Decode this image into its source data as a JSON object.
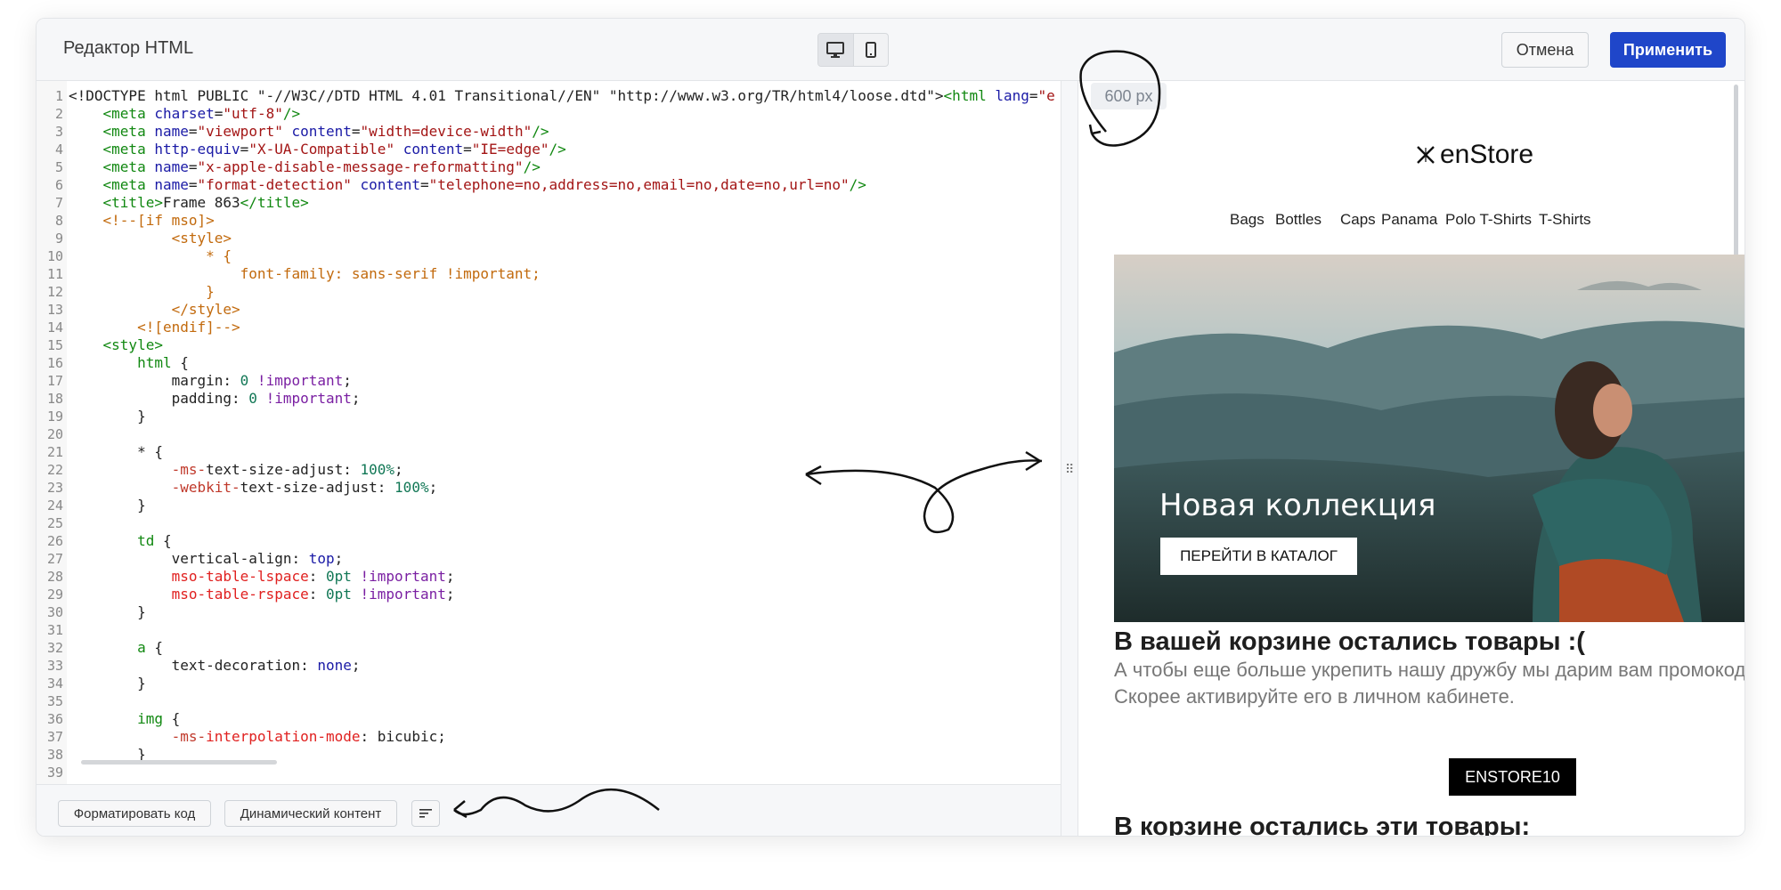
{
  "header": {
    "title": "Редактор HTML",
    "cancel_label": "Отмена",
    "apply_label": "Применить",
    "device_buttons": [
      "desktop-icon",
      "mobile-icon"
    ]
  },
  "editor": {
    "lines": [
      {
        "n": "1",
        "segs": [
          [
            "<!DOCTYPE html PUBLIC \"-//W3C//DTD HTML 4.01 Transitional//EN\" \"http://www.w3.org/TR/html4/loose.dtd\">",
            "#222"
          ],
          [
            "<html",
            "#118811"
          ],
          [
            " lang",
            "#1a1aa6"
          ],
          [
            "=",
            "#222"
          ],
          [
            "\"e",
            "#a31515"
          ]
        ]
      },
      {
        "n": "2",
        "segs": [
          [
            "    <meta",
            "#118811"
          ],
          [
            " charset",
            "#1a1aa6"
          ],
          [
            "=",
            "#222"
          ],
          [
            "\"utf-8\"",
            "#a31515"
          ],
          [
            "/>",
            "#118811"
          ]
        ]
      },
      {
        "n": "3",
        "segs": [
          [
            "    <meta",
            "#118811"
          ],
          [
            " name",
            "#1a1aa6"
          ],
          [
            "=",
            "#222"
          ],
          [
            "\"viewport\"",
            "#a31515"
          ],
          [
            " content",
            "#1a1aa6"
          ],
          [
            "=",
            "#222"
          ],
          [
            "\"width=device-width\"",
            "#a31515"
          ],
          [
            "/>",
            "#118811"
          ]
        ]
      },
      {
        "n": "4",
        "segs": [
          [
            "    <meta",
            "#118811"
          ],
          [
            " http-equiv",
            "#1a1aa6"
          ],
          [
            "=",
            "#222"
          ],
          [
            "\"X-UA-Compatible\"",
            "#a31515"
          ],
          [
            " content",
            "#1a1aa6"
          ],
          [
            "=",
            "#222"
          ],
          [
            "\"IE=edge\"",
            "#a31515"
          ],
          [
            "/>",
            "#118811"
          ]
        ]
      },
      {
        "n": "5",
        "segs": [
          [
            "    <meta",
            "#118811"
          ],
          [
            " name",
            "#1a1aa6"
          ],
          [
            "=",
            "#222"
          ],
          [
            "\"x-apple-disable-message-reformatting\"",
            "#a31515"
          ],
          [
            "/>",
            "#118811"
          ]
        ]
      },
      {
        "n": "6",
        "segs": [
          [
            "    <meta",
            "#118811"
          ],
          [
            " name",
            "#1a1aa6"
          ],
          [
            "=",
            "#222"
          ],
          [
            "\"format-detection\"",
            "#a31515"
          ],
          [
            " content",
            "#1a1aa6"
          ],
          [
            "=",
            "#222"
          ],
          [
            "\"telephone=no,address=no,email=no,date=no,url=no\"",
            "#a31515"
          ],
          [
            "/>",
            "#118811"
          ]
        ]
      },
      {
        "n": "7",
        "segs": [
          [
            "    <title>",
            "#118811"
          ],
          [
            "Frame 863",
            "#222"
          ],
          [
            "</title>",
            "#118811"
          ]
        ]
      },
      {
        "n": "8",
        "segs": [
          [
            "    <!--[if mso]>",
            "#c26a0d"
          ]
        ]
      },
      {
        "n": "9",
        "segs": [
          [
            "            <style>",
            "#c26a0d"
          ]
        ]
      },
      {
        "n": "10",
        "segs": [
          [
            "                * {",
            "#c26a0d"
          ]
        ]
      },
      {
        "n": "11",
        "segs": [
          [
            "                    font-family: sans-serif !important;",
            "#c26a0d"
          ]
        ]
      },
      {
        "n": "12",
        "segs": [
          [
            "                }",
            "#c26a0d"
          ]
        ]
      },
      {
        "n": "13",
        "segs": [
          [
            "            </style>",
            "#c26a0d"
          ]
        ]
      },
      {
        "n": "14",
        "segs": [
          [
            "        <![endif]-->",
            "#c26a0d"
          ]
        ]
      },
      {
        "n": "15",
        "segs": [
          [
            "    <style>",
            "#118811"
          ]
        ]
      },
      {
        "n": "16",
        "segs": [
          [
            "        html",
            "#118811"
          ],
          [
            " {",
            "#222"
          ]
        ]
      },
      {
        "n": "17",
        "segs": [
          [
            "            margin: ",
            "#222"
          ],
          [
            "0",
            "#117755"
          ],
          [
            " !important",
            "#7a1fa2"
          ],
          [
            ";",
            "#222"
          ]
        ]
      },
      {
        "n": "18",
        "segs": [
          [
            "            padding: ",
            "#222"
          ],
          [
            "0",
            "#117755"
          ],
          [
            " !important",
            "#7a1fa2"
          ],
          [
            ";",
            "#222"
          ]
        ]
      },
      {
        "n": "19",
        "segs": [
          [
            "        }",
            "#222"
          ]
        ]
      },
      {
        "n": "20",
        "segs": [
          [
            "",
            "#222"
          ]
        ]
      },
      {
        "n": "21",
        "segs": [
          [
            "        * {",
            "#222"
          ]
        ]
      },
      {
        "n": "22",
        "segs": [
          [
            "            -ms-",
            "#c0392b"
          ],
          [
            "text-size-adjust: ",
            "#222"
          ],
          [
            "100%",
            "#117755"
          ],
          [
            ";",
            "#222"
          ]
        ]
      },
      {
        "n": "23",
        "segs": [
          [
            "            -webkit-",
            "#c0392b"
          ],
          [
            "text-size-adjust: ",
            "#222"
          ],
          [
            "100%",
            "#117755"
          ],
          [
            ";",
            "#222"
          ]
        ]
      },
      {
        "n": "24",
        "segs": [
          [
            "        }",
            "#222"
          ]
        ]
      },
      {
        "n": "25",
        "segs": [
          [
            "",
            "#222"
          ]
        ]
      },
      {
        "n": "26",
        "segs": [
          [
            "        td",
            "#118811"
          ],
          [
            " {",
            "#222"
          ]
        ]
      },
      {
        "n": "27",
        "segs": [
          [
            "            vertical-align: ",
            "#222"
          ],
          [
            "top",
            "#1a1aa6"
          ],
          [
            ";",
            "#222"
          ]
        ]
      },
      {
        "n": "28",
        "segs": [
          [
            "            mso-table-lspace",
            "#e0201f"
          ],
          [
            ": ",
            "#222"
          ],
          [
            "0pt",
            "#117755"
          ],
          [
            " !important",
            "#7a1fa2"
          ],
          [
            ";",
            "#222"
          ]
        ]
      },
      {
        "n": "29",
        "segs": [
          [
            "            mso-table-rspace",
            "#e0201f"
          ],
          [
            ": ",
            "#222"
          ],
          [
            "0pt",
            "#117755"
          ],
          [
            " !important",
            "#7a1fa2"
          ],
          [
            ";",
            "#222"
          ]
        ]
      },
      {
        "n": "30",
        "segs": [
          [
            "        }",
            "#222"
          ]
        ]
      },
      {
        "n": "31",
        "segs": [
          [
            "",
            "#222"
          ]
        ]
      },
      {
        "n": "32",
        "segs": [
          [
            "        a",
            "#118811"
          ],
          [
            " {",
            "#222"
          ]
        ]
      },
      {
        "n": "33",
        "segs": [
          [
            "            text-decoration: ",
            "#222"
          ],
          [
            "none",
            "#1a1aa6"
          ],
          [
            ";",
            "#222"
          ]
        ]
      },
      {
        "n": "34",
        "segs": [
          [
            "        }",
            "#222"
          ]
        ]
      },
      {
        "n": "35",
        "segs": [
          [
            "",
            "#222"
          ]
        ]
      },
      {
        "n": "36",
        "segs": [
          [
            "        img",
            "#118811"
          ],
          [
            " {",
            "#222"
          ]
        ]
      },
      {
        "n": "37",
        "segs": [
          [
            "            -ms-",
            "#c0392b"
          ],
          [
            "interpolation-mode",
            "#e0201f"
          ],
          [
            ": bicubic;",
            "#222"
          ]
        ]
      },
      {
        "n": "38",
        "segs": [
          [
            "        }",
            "#222"
          ]
        ]
      },
      {
        "n": "39",
        "segs": [
          [
            "",
            "#222"
          ]
        ]
      }
    ]
  },
  "footer": {
    "format_label": "Форматировать код",
    "dynamic_label": "Динамический контент"
  },
  "preview": {
    "width_badge": "600 px",
    "logo_text": "enStore",
    "nav": [
      "Bags",
      "Bottles",
      "Caps",
      "Panama",
      "Polo T-Shirts",
      "T-Shirts"
    ],
    "hero_title": "Новая коллекция",
    "hero_button": "ПЕРЕЙТИ В КАТАЛОГ",
    "cart_heading": "В вашей корзине остались товары :(",
    "promo_text_1": "А чтобы еще больше укрепить нашу дружбу мы дарим вам промокод",
    "promo_text_2": "Скорее активируйте его в личном кабинете.",
    "promo_code": "ENSTORE10",
    "items_heading": "В корзине остались эти товары:"
  },
  "colors": {
    "accent": "#1f46c9",
    "header_bg": "#f6f7f9",
    "promo_bg": "#000000"
  }
}
